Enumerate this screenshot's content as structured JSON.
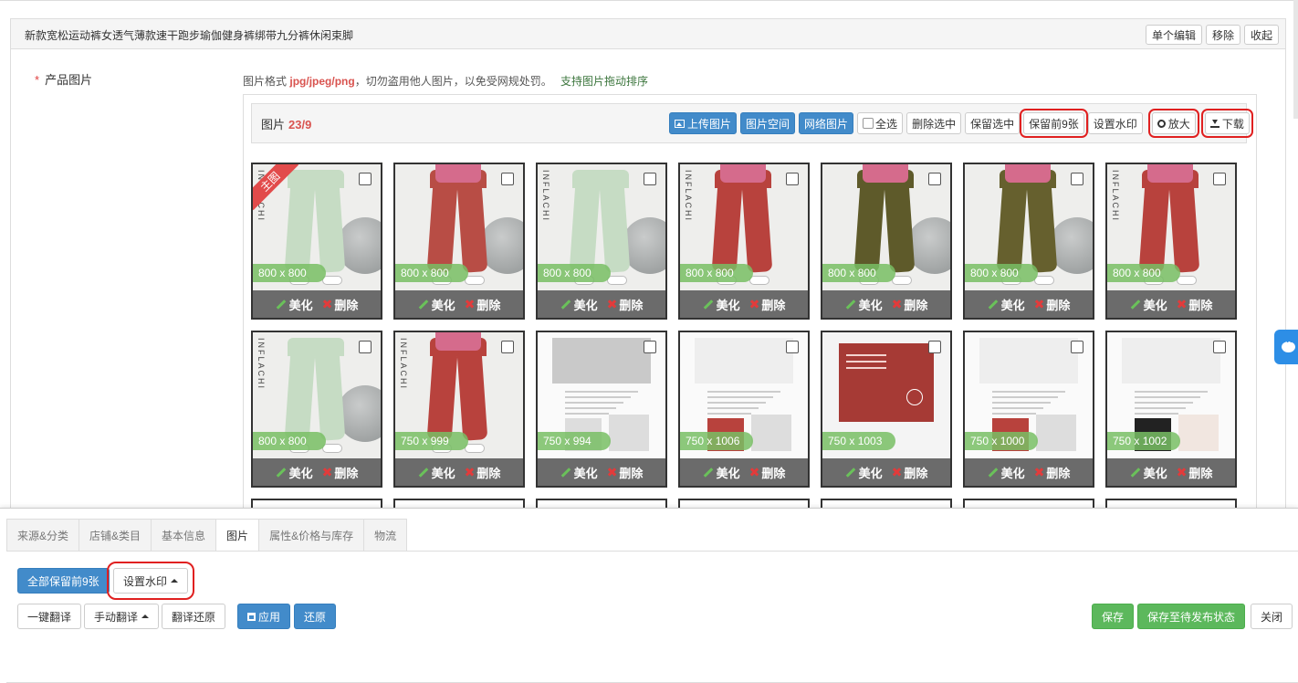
{
  "product": {
    "title": "新款宽松运动裤女透气薄款速干跑步瑜伽健身裤绑带九分裤休闲束脚",
    "actions": {
      "edit": "单个编辑",
      "remove": "移除",
      "collapse": "收起"
    }
  },
  "images_field": {
    "required_mark": "*",
    "label": "产品图片",
    "hint_prefix": "图片格式",
    "hint_formats": "jpg/jpeg/png",
    "hint_suffix": "，切勿盗用他人图片，以免受网规处罚。",
    "hint_sort": "支持图片拖动排序"
  },
  "toolbar": {
    "count_label": "图片",
    "count_value": "23/9",
    "upload": "上传图片",
    "space": "图片空间",
    "web": "网络图片",
    "select_all": "全选",
    "delete_selected": "删除选中",
    "keep_selected": "保留选中",
    "keep_first9": "保留前9张",
    "watermark": "设置水印",
    "zoom": "放大",
    "download": "下载"
  },
  "thumb_actions": {
    "beautify": "美化",
    "delete": "删除"
  },
  "main_ribbon": "主图",
  "brand_text": "INFLACHI",
  "images": [
    {
      "size": "800 x 800",
      "color": "#c6dcc4",
      "style": "green",
      "main": true
    },
    {
      "size": "800 x 800",
      "color": "#b84d45",
      "style": "red-pose"
    },
    {
      "size": "800 x 800",
      "color": "#c6dcc4",
      "style": "green"
    },
    {
      "size": "800 x 800",
      "color": "#b8423d",
      "style": "red"
    },
    {
      "size": "800 x 800",
      "color": "#5e5a2a",
      "style": "olive"
    },
    {
      "size": "800 x 800",
      "color": "#66602e",
      "style": "olive"
    },
    {
      "size": "800 x 800",
      "color": "#b8423d",
      "style": "red"
    },
    {
      "size": "800 x 800",
      "color": "#c6dcc4",
      "style": "green"
    },
    {
      "size": "750 x 999",
      "color": "#b8423d",
      "style": "red"
    },
    {
      "size": "750 x 994",
      "color": "#dddddd",
      "style": "doc"
    },
    {
      "size": "750 x 1006",
      "color": "#b8423d",
      "style": "doc-red"
    },
    {
      "size": "750 x 1003",
      "color": "#a63a35",
      "style": "card"
    },
    {
      "size": "750 x 1000",
      "color": "#b8423d",
      "style": "doc-mix"
    },
    {
      "size": "750 x 1002",
      "color": "#222222",
      "style": "doc-pose"
    }
  ],
  "tabs": [
    "来源&分类",
    "店铺&类目",
    "基本信息",
    "图片",
    "属性&价格与库存",
    "物流"
  ],
  "active_tab": "图片",
  "bottom": {
    "keep_all_first9": "全部保留前9张",
    "set_watermark": "设置水印",
    "one_click_translate": "一键翻译",
    "manual_translate": "手动翻译",
    "translate_restore": "翻译还原",
    "apply": "应用",
    "restore": "还原",
    "save": "保存",
    "save_pending": "保存至待发布状态",
    "close": "关闭"
  },
  "colors": {
    "primary": "#428bca",
    "success": "#5cb85c",
    "danger": "#d9534f",
    "highlight": "#e02020"
  }
}
